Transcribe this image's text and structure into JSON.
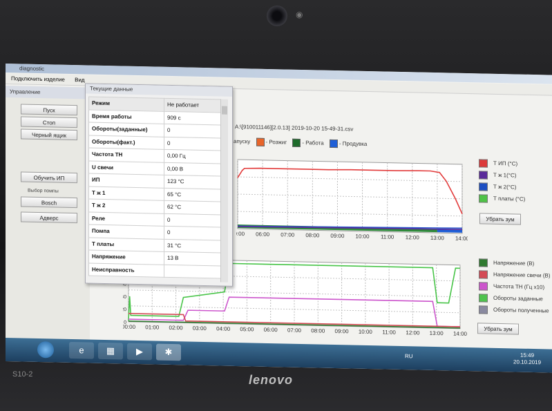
{
  "laptop": {
    "model": "S10-2",
    "brand": "lenovo"
  },
  "window": {
    "title": "diagnostic",
    "menu": [
      "Подключить изделие",
      "Вид"
    ]
  },
  "left_panel": {
    "header": "Управление",
    "buttons": [
      "Пуск",
      "Стоп",
      "Черный ящик",
      "Обучить ИП",
      "Bosch",
      "Адверс"
    ],
    "pump_label": "Выбор помпы"
  },
  "popup": {
    "title": "Текущие данные",
    "rows": [
      {
        "key": "Режим",
        "value": "Не работает"
      },
      {
        "key": "Время работы",
        "value": "909 с"
      },
      {
        "key": "Обороты(заданные)",
        "value": "0"
      },
      {
        "key": "Обороты(факт.)",
        "value": "0"
      },
      {
        "key": "Частота ТН",
        "value": "0,00 Гц"
      },
      {
        "key": "U свечи",
        "value": "0,00 В"
      },
      {
        "key": "ИП",
        "value": "123 °C"
      },
      {
        "key": "Т ж 1",
        "value": "65 °C"
      },
      {
        "key": "Т ж 2",
        "value": "62 °C"
      },
      {
        "key": "Реле",
        "value": "0"
      },
      {
        "key": "Помпа",
        "value": "0"
      },
      {
        "key": "Т платы",
        "value": "31 °C"
      },
      {
        "key": "Напряжение",
        "value": "13 В"
      },
      {
        "key": "Неисправность",
        "value": ""
      }
    ]
  },
  "file_path": "A:\\[910011146][2.0.13] 2019-10-20 15-49-31.csv",
  "mode_legend": [
    {
      "label": "апуску",
      "color": ""
    },
    {
      "label": "- Розжиг",
      "color": "#e8652a"
    },
    {
      "label": "- Работа",
      "color": "#1d6b2a"
    },
    {
      "label": "- Продувка",
      "color": "#1f5fd6"
    }
  ],
  "chart_top": {
    "legend": [
      {
        "label": "Т ИП (°C)",
        "color": "#dc3a3a"
      },
      {
        "label": "Т ж 1(°C)",
        "color": "#5a2a9a"
      },
      {
        "label": "Т ж 2(°C)",
        "color": "#1d4fc2"
      },
      {
        "label": "Т платы (°C)",
        "color": "#4fc247"
      }
    ],
    "zoom_label": "Убрать зум"
  },
  "chart_bottom": {
    "legend": [
      {
        "label": "Напряжение (В)",
        "color": "#2f7a2f"
      },
      {
        "label": "Напряжение свечи (В)",
        "color": "#d44a55"
      },
      {
        "label": "Частота ТН (Гц х10)",
        "color": "#cc55cc"
      },
      {
        "label": "Обороты заданные",
        "color": "#4ec24e"
      },
      {
        "label": "Обороты полученные",
        "color": "#8a8aa0"
      }
    ],
    "zoom_label": "Убрать зум"
  },
  "chart_data": [
    {
      "type": "line",
      "x_ticks": [
        "00:00",
        "06:00",
        "07:00",
        "08:00",
        "09:00",
        "10:00",
        "11:00",
        "12:00",
        "13:00",
        "14:00"
      ],
      "series": [
        {
          "name": "Т ИП (°C)",
          "color": "#e23b3b",
          "x": [
            0,
            0.2,
            0.3,
            1,
            2,
            3,
            4,
            5,
            6,
            7,
            8,
            8.5,
            8.9,
            9.2,
            9.6,
            9.9
          ],
          "y": [
            118,
            135,
            140,
            141,
            141,
            141,
            141,
            142,
            142,
            142,
            143,
            143,
            140,
            120,
            80,
            45
          ]
        },
        {
          "name": "Т ж 2(°C)",
          "color": "#2a55c9",
          "x": [
            0,
            5,
            9.9
          ],
          "y": [
            6,
            9,
            12
          ]
        },
        {
          "name": "Т ж 1(°C)",
          "color": "#5a2a9a",
          "x": [
            0,
            5,
            9.9
          ],
          "y": [
            5,
            7,
            9
          ]
        }
      ],
      "mode_bar": [
        {
          "from": 0,
          "to": 8.8,
          "color": "#2f8a3a"
        },
        {
          "from": 8.8,
          "to": 9.9,
          "color": "#1f5fd6"
        }
      ],
      "ylim": [
        0,
        160
      ]
    },
    {
      "type": "line",
      "x_ticks": [
        "00:00",
        "01:00",
        "02:00",
        "03:00",
        "04:00",
        "05:00",
        "06:00",
        "07:00",
        "08:00",
        "09:00",
        "10:00",
        "11:00",
        "12:00",
        "13:00",
        "14:00"
      ],
      "y_ticks": [
        0,
        20,
        40,
        60,
        80
      ],
      "ylim": [
        0,
        100
      ],
      "series": [
        {
          "name": "Обороты заданные",
          "color": "#47c447",
          "x": [
            0,
            0.05,
            0.1,
            2.2,
            2.4,
            4.2,
            4.4,
            13.3,
            13.5,
            14.0,
            14.3,
            14.5
          ],
          "y": [
            2,
            40,
            10,
            10,
            40,
            50,
            95,
            95,
            40,
            40,
            95,
            95
          ]
        },
        {
          "name": "Частота ТН (Гц х10)",
          "color": "#cc55cc",
          "x": [
            0,
            2.4,
            2.6,
            4.2,
            4.4,
            13.3,
            13.5,
            14.5
          ],
          "y": [
            4,
            4,
            20,
            20,
            42,
            42,
            3,
            3
          ]
        },
        {
          "name": "Напряжение свечи (В)",
          "color": "#d44a55",
          "x": [
            0,
            2.4,
            2.5,
            14.5
          ],
          "y": [
            13,
            13,
            3,
            3
          ]
        },
        {
          "name": "Напряжение (В)",
          "color": "#2f7a2f",
          "x": [
            0,
            14.5
          ],
          "y": [
            1,
            1
          ]
        }
      ]
    }
  ],
  "taskbar": {
    "apps": [
      "e",
      "▦",
      "▶",
      "✱"
    ],
    "lang": "RU",
    "time": "15:49",
    "date": "20.10.2019"
  }
}
